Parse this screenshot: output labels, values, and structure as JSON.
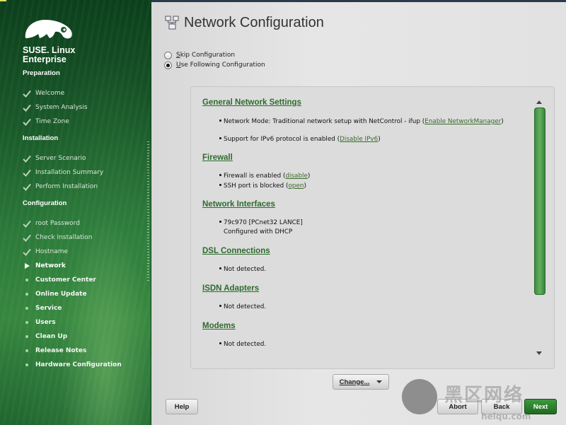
{
  "brand": {
    "line1": "SUSE. Linux",
    "line2": "Enterprise"
  },
  "sections": [
    {
      "title": "Preparation",
      "steps": [
        {
          "label": "Welcome",
          "state": "done"
        },
        {
          "label": "System Analysis",
          "state": "done"
        },
        {
          "label": "Time Zone",
          "state": "done"
        }
      ]
    },
    {
      "title": "Installation",
      "steps": [
        {
          "label": "Server Scenario",
          "state": "done"
        },
        {
          "label": "Installation Summary",
          "state": "done"
        },
        {
          "label": "Perform Installation",
          "state": "done"
        }
      ]
    },
    {
      "title": "Configuration",
      "steps": [
        {
          "label": "root Password",
          "state": "done"
        },
        {
          "label": "Check Installation",
          "state": "done"
        },
        {
          "label": "Hostname",
          "state": "done"
        },
        {
          "label": "Network",
          "state": "current"
        },
        {
          "label": "Customer Center",
          "state": "pending"
        },
        {
          "label": "Online Update",
          "state": "pending"
        },
        {
          "label": "Service",
          "state": "pending"
        },
        {
          "label": "Users",
          "state": "pending"
        },
        {
          "label": "Clean Up",
          "state": "pending"
        },
        {
          "label": "Release Notes",
          "state": "pending"
        },
        {
          "label": "Hardware Configuration",
          "state": "pending"
        }
      ]
    }
  ],
  "page": {
    "title": "Network Configuration"
  },
  "options": {
    "skip": {
      "prefix": "S",
      "rest": "kip Configuration",
      "selected": false
    },
    "use": {
      "prefix": "U",
      "rest": "se Following Configuration",
      "selected": true
    }
  },
  "summary": {
    "general": {
      "title": "General Network Settings",
      "nm_text": "Network Mode: Traditional network setup with NetControl - ifup (",
      "nm_link": "Enable NetworkManager",
      "nm_close": ")",
      "ipv6_text": "Support for IPv6 protocol is enabled (",
      "ipv6_link": "Disable IPv6",
      "ipv6_close": ")"
    },
    "firewall": {
      "title": "Firewall",
      "fw_text": "Firewall is enabled (",
      "fw_link": "disable",
      "fw_close": ")",
      "ssh_text": "SSH port is blocked (",
      "ssh_link": "open",
      "ssh_close": ")"
    },
    "interfaces": {
      "title": "Network Interfaces",
      "line1": "79c970 [PCnet32 LANCE]",
      "line2": "Configured with DHCP"
    },
    "dsl": {
      "title": "DSL Connections",
      "text": "Not detected."
    },
    "isdn": {
      "title": "ISDN Adapters",
      "text": "Not detected."
    },
    "modems": {
      "title": "Modems",
      "text": "Not detected."
    }
  },
  "buttons": {
    "change": "Change...",
    "help": "Help",
    "abort": "Abort",
    "back": "Back",
    "next": "Next"
  },
  "watermark": {
    "text": "黑区网络",
    "url": "heiqu.com"
  },
  "colors": {
    "accent": "#2d6b2d",
    "sidebar": "#1a5a2a",
    "next": "#2a7f2a"
  }
}
